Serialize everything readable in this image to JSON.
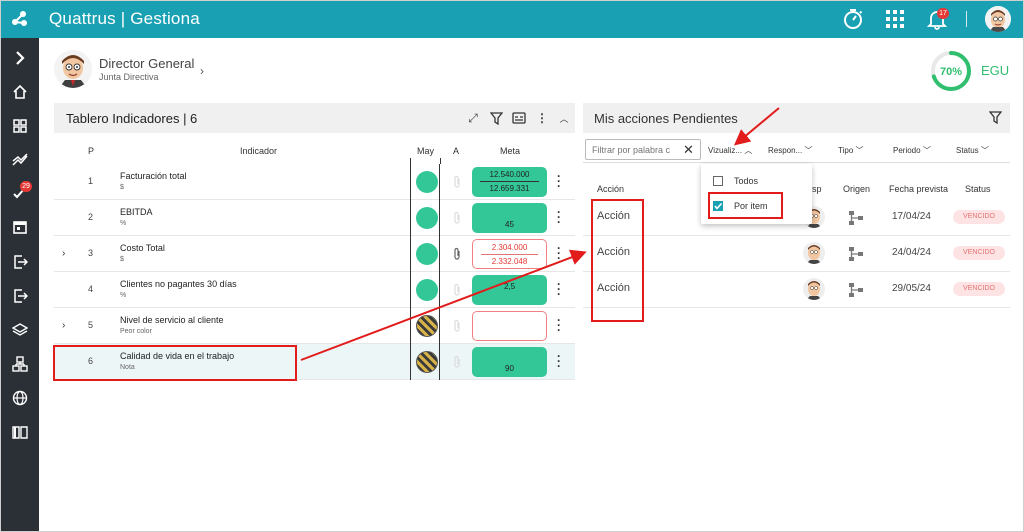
{
  "app": {
    "title": "Quattrus | Gestiona",
    "notifications": "17"
  },
  "sidebar": {
    "tasks_badge": "29",
    "items": [
      "expand-icon",
      "home-icon",
      "dashboard-icon",
      "chart-icon",
      "tasks-icon",
      "calendar-icon",
      "logout-icon",
      "exit-icon",
      "layers-icon",
      "modules-icon",
      "globe-icon",
      "book-icon"
    ]
  },
  "profile": {
    "role": "Director General",
    "group": "Junta Directiva"
  },
  "egu": {
    "percent": "70%",
    "label": "EGU",
    "value": 0.7
  },
  "tablero": {
    "title": "Tablero Indicadores | 6",
    "columns": {
      "p": "P",
      "indicador": "Indicador",
      "may": "May",
      "a": "A",
      "meta": "Meta"
    },
    "rows": [
      {
        "num": "1",
        "name": "Facturación total",
        "unit": "$",
        "meta1": "12.540.000",
        "meta2": "12.659.331"
      },
      {
        "num": "2",
        "name": "EBITDA",
        "unit": "%",
        "meta1": "",
        "meta2": "45"
      },
      {
        "num": "3",
        "name": "Costo Total",
        "unit": "$",
        "meta1": "2.304.000",
        "meta2": "2.332.048"
      },
      {
        "num": "4",
        "name": "Clientes no pagantes 30 días",
        "unit": "%",
        "meta1": "",
        "meta2": "2,5"
      },
      {
        "num": "5",
        "name": "Nivel de servicio al cliente",
        "unit": "Peor color",
        "meta1": "",
        "meta2": ""
      },
      {
        "num": "6",
        "name": "Calidad de vida en el trabajo",
        "unit": "Nota",
        "meta1": "",
        "meta2": "90"
      }
    ]
  },
  "acciones": {
    "title": "Mis acciones Pendientes",
    "filter_placeholder": "Filtrar por palabra c",
    "filters": {
      "vizualiz": "Vizualiz...",
      "respon": "Respon...",
      "tipo": "Tipo",
      "periodo": "Periodo",
      "status": "Status"
    },
    "columns": {
      "accion": "Acción",
      "resp": "sp",
      "origen": "Origen",
      "fecha": "Fecha prevista",
      "status": "Status"
    },
    "rows": [
      {
        "accion": "Acción",
        "fecha": "17/04/24",
        "status": "VENCIDO"
      },
      {
        "accion": "Acción",
        "fecha": "24/04/24",
        "status": "VENCIDO"
      },
      {
        "accion": "Acción",
        "fecha": "29/05/24",
        "status": "VENCIDO"
      }
    ],
    "dropdown": {
      "todos": "Todos",
      "por_item": "Por item"
    }
  },
  "colors": {
    "brand": "#1aa0b3",
    "sidebar": "#2b3036",
    "green": "#33c797",
    "annotation_red": "#e21b1b"
  }
}
